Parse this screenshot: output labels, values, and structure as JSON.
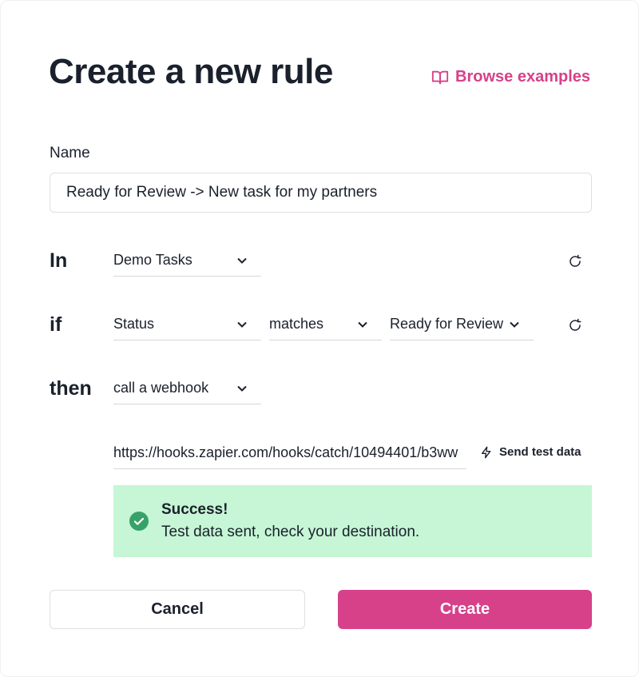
{
  "header": {
    "title": "Create a new rule",
    "browse_label": "Browse examples"
  },
  "name": {
    "label": "Name",
    "value": "Ready for Review -> New task for my partners"
  },
  "rule": {
    "in_label": "In",
    "in_select": "Demo Tasks",
    "if_label": "if",
    "if_field": "Status",
    "if_operator": "matches",
    "if_value": "Ready for Review",
    "then_label": "then",
    "then_action": "call a webhook",
    "webhook_url": "https://hooks.zapier.com/hooks/catch/10494401/b3ww",
    "send_test_label": "Send test data"
  },
  "alert": {
    "title": "Success!",
    "message": "Test data sent, check your destination."
  },
  "footer": {
    "cancel_label": "Cancel",
    "create_label": "Create"
  },
  "colors": {
    "accent": "#d6418a",
    "success_bg": "#c6f6d5",
    "success_icon": "#38a169",
    "text": "#1a202c"
  },
  "icons": {
    "browse": "book-icon",
    "refresh": "refresh-icon",
    "send_test": "lightning-icon",
    "success": "check-circle-icon",
    "select": "chevron-down-icon"
  }
}
